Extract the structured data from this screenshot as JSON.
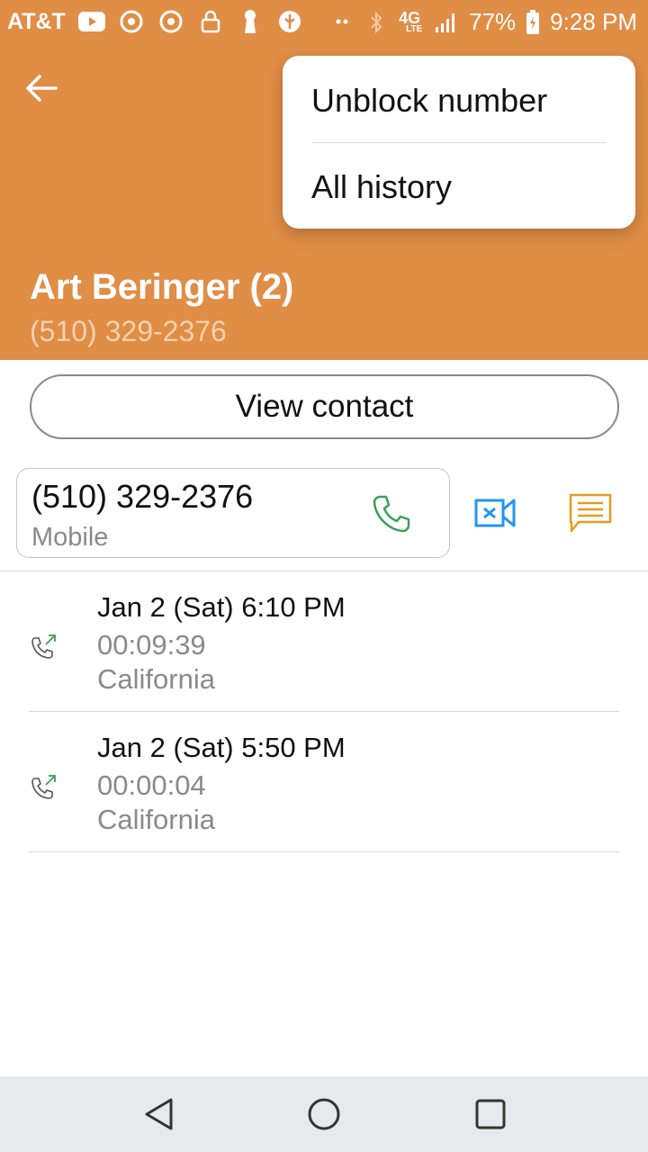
{
  "status_bar": {
    "carrier": "AT&T",
    "network": "4G",
    "network_sub": "LTE",
    "battery": "77%",
    "time": "9:28 PM",
    "left_icons": [
      "youtube-icon",
      "chrome-icon",
      "chrome-icon",
      "lock-icon",
      "keyhole-icon",
      "usb-icon",
      "more-dots-icon"
    ],
    "right_icons": [
      "bluetooth-icon",
      "signal-icon",
      "battery-charging-icon"
    ]
  },
  "header": {
    "contact_name": "Art Beringer (2)",
    "phone_number": "(510) 329-2376",
    "color": "#e08d46"
  },
  "menu": {
    "items": [
      {
        "label": "Unblock number"
      },
      {
        "label": "All history"
      }
    ]
  },
  "actions": {
    "view_contact": "View contact"
  },
  "number_card": {
    "number": "(510) 329-2376",
    "type": "Mobile"
  },
  "history": [
    {
      "date": "Jan 2 (Sat) 6:10 PM",
      "duration": "00:09:39",
      "location": "California",
      "icon": "outgoing-call-icon"
    },
    {
      "date": "Jan 2 (Sat) 5:50 PM",
      "duration": "00:00:04",
      "location": "California",
      "icon": "outgoing-call-icon"
    }
  ],
  "colors": {
    "accent": "#e08d46",
    "call_green": "#3aa156",
    "video_blue": "#2196f3",
    "message_orange": "#e69a1e"
  }
}
